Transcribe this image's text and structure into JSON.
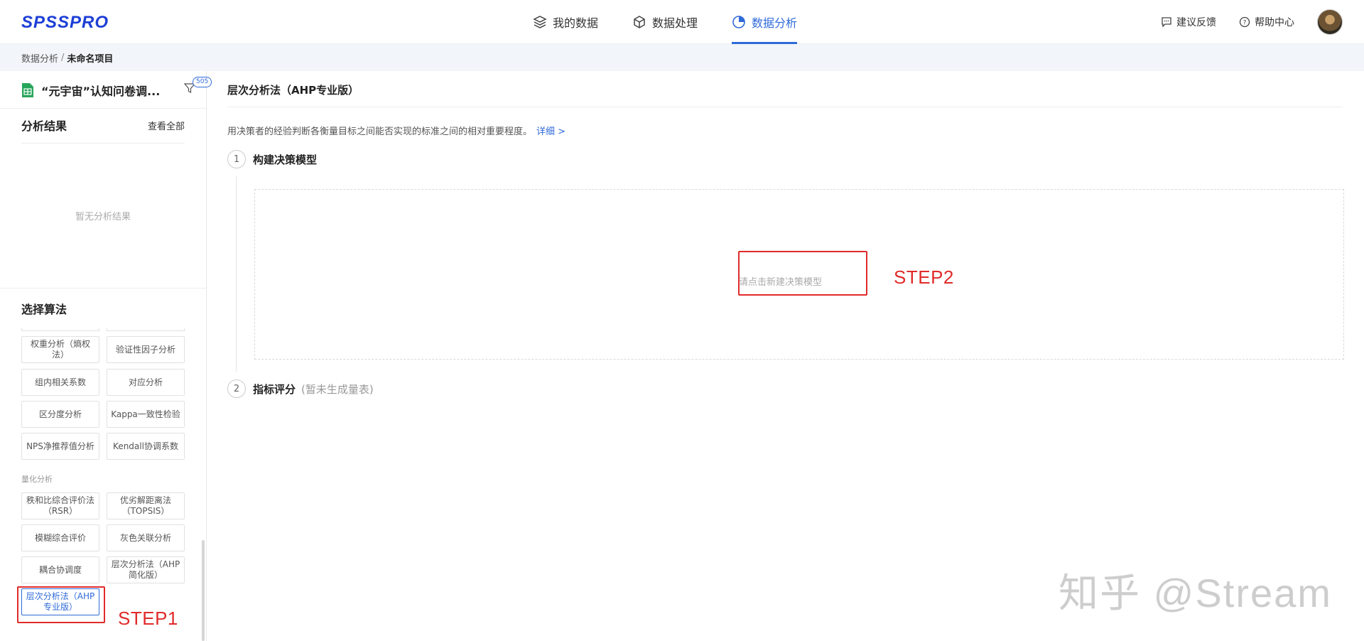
{
  "app": {
    "logo": "SPSSPRO"
  },
  "nav": {
    "items": [
      {
        "label": "我的数据",
        "icon": "layers-icon"
      },
      {
        "label": "数据处理",
        "icon": "cube-icon"
      },
      {
        "label": "数据分析",
        "icon": "pie-chart-icon",
        "active": true
      }
    ]
  },
  "topright": {
    "feedback": "建议反馈",
    "help": "帮助中心"
  },
  "breadcrumb": {
    "parent": "数据分析",
    "separator": "/",
    "current": "未命名项目"
  },
  "sidebar": {
    "dataset_name": "“元宇宙”认知问卷调...",
    "filter_badge": "505",
    "results_title": "分析结果",
    "view_all": "查看全部",
    "results_empty": "暂无分析结果",
    "algo_title": "选择算法",
    "algos_a": [
      "权重分析（熵权法）",
      "验证性因子分析",
      "组内相关系数",
      "对应分析",
      "区分度分析",
      "Kappa一致性检验",
      "NPS净推荐值分析",
      "Kendall协调系数"
    ],
    "group_label": "量化分析",
    "algos_b": [
      "秩和比综合评价法（RSR）",
      "优劣解距离法（TOPSIS）",
      "模糊综合评价",
      "灰色关联分析",
      "耦合协调度",
      "层次分析法（AHP简化版）",
      "层次分析法（AHP专业版）"
    ]
  },
  "annotations": {
    "step1": "STEP1",
    "step2": "STEP2",
    "color": "#e02b2b"
  },
  "main": {
    "heading": "层次分析法（AHP专业版）",
    "description": "用决策者的经验判断各衡量目标之间能否实现的标准之间的相对重要程度。",
    "more_link": "详细 >",
    "step1": {
      "num": "1",
      "title": "构建决策模型"
    },
    "model_hint": "请点击新建决策模型",
    "step2": {
      "num": "2",
      "title": "指标评分",
      "sub": "(暂未生成量表)"
    }
  },
  "watermark": "知乎 @Stream",
  "colors": {
    "accent": "#2f6ad9",
    "logo": "#1d3fd6"
  }
}
